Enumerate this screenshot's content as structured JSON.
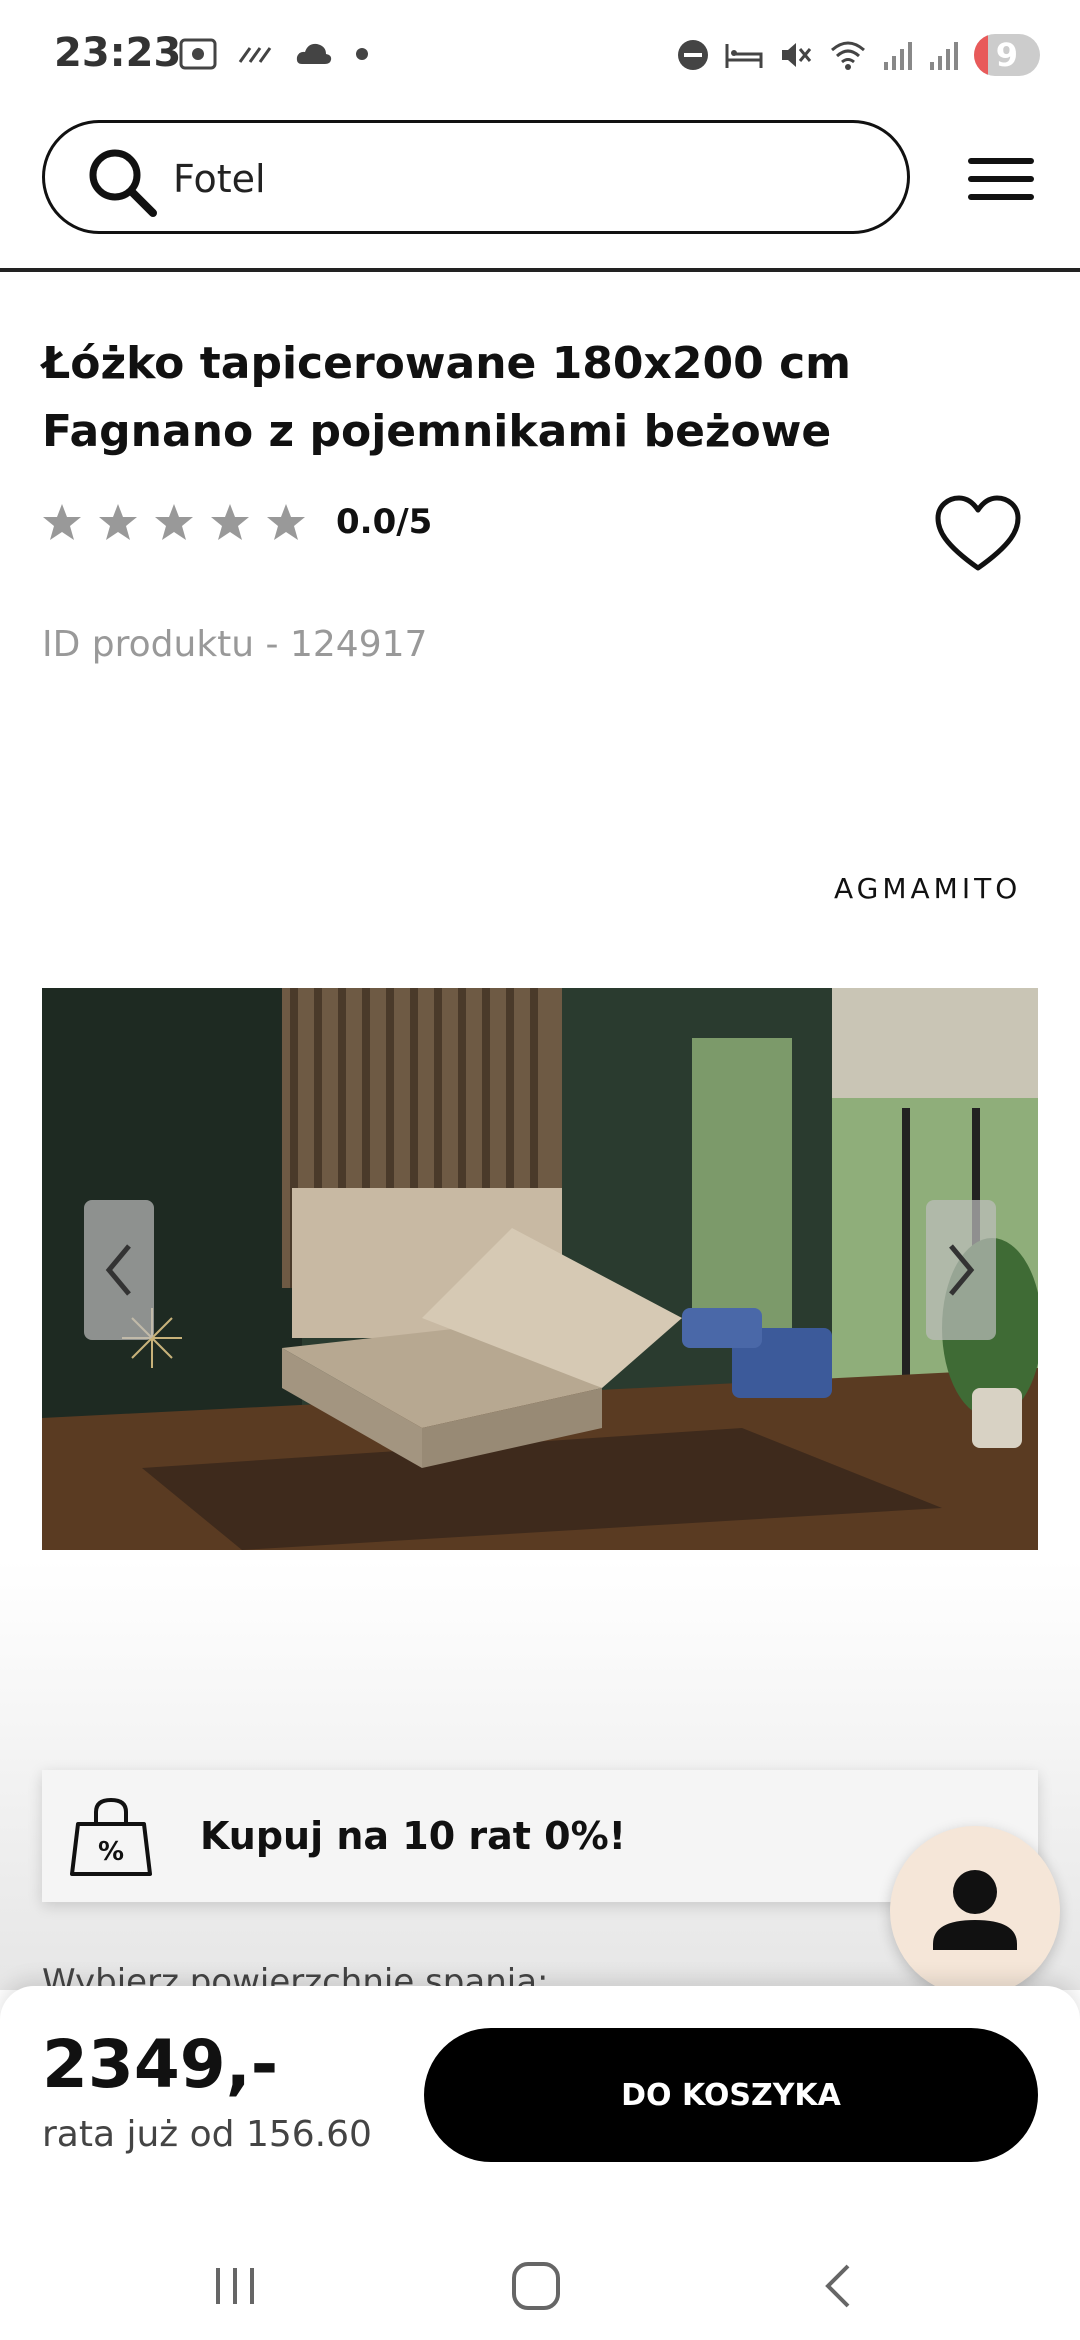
{
  "status_bar": {
    "time": "23:23",
    "battery": "9"
  },
  "search": {
    "value": "Fotel"
  },
  "product": {
    "title": "Łóżko tapicerowane 180x200 cm Fagnano z pojemnikami beżowe",
    "rating": "0.0/5",
    "stars_filled": 0,
    "stars_total": 5,
    "id_text": "ID produktu - 124917",
    "brand": "AGMAMITO"
  },
  "promo": {
    "installments_label": "Kupuj na 10 rat 0%!",
    "sleep_surface_label": "Wybierz powierzchnię spania:"
  },
  "purchase": {
    "price": "2349,-",
    "installment_note": "rata już od 156.60",
    "cart_button": "DO KOSZYKA"
  },
  "colors": {
    "accent": "#000000",
    "chat_bg": "#f5e6d8",
    "star_empty": "#999999"
  }
}
